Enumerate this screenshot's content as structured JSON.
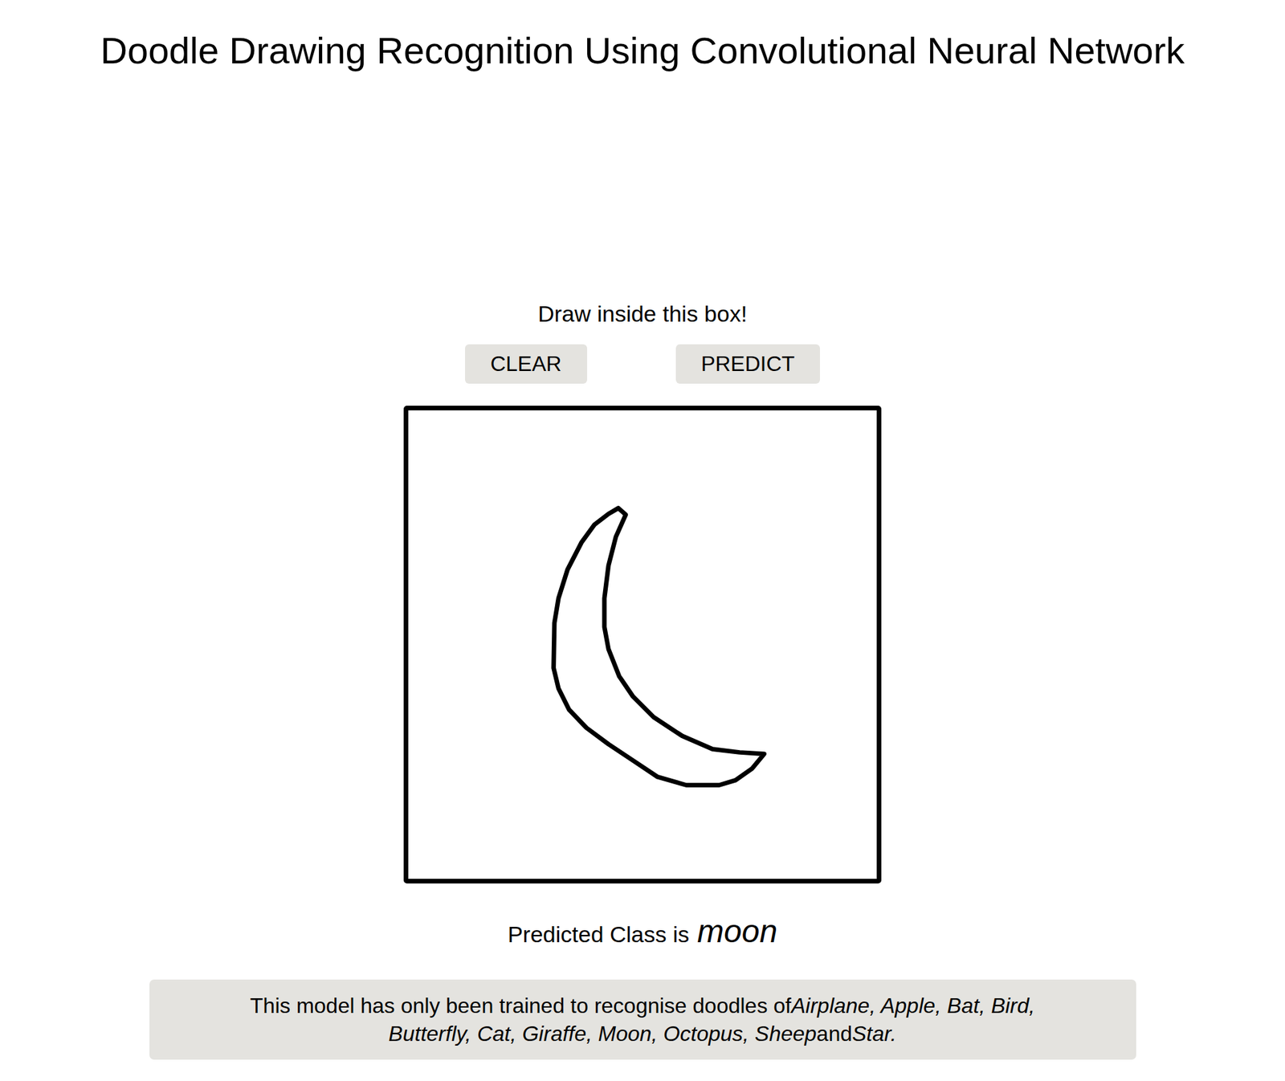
{
  "page": {
    "title": "Doodle Drawing Recognition Using Convolutional Neural Network"
  },
  "canvas": {
    "prompt": "Draw inside this box!"
  },
  "buttons": [
    {
      "label": "CLEAR"
    },
    {
      "label": "PREDICT"
    }
  ],
  "result": {
    "prefix": "Predicted Class is",
    "predicted": "moon"
  },
  "note": {
    "text": "This model has only been trained to recognise doodles of",
    "classes": "Airplane, Apple, Bat, Bird, Butterfly, Cat, Giraffe, Moon, Octopus, Sheep",
    "conjunction": "and",
    "last_class": "Star."
  }
}
